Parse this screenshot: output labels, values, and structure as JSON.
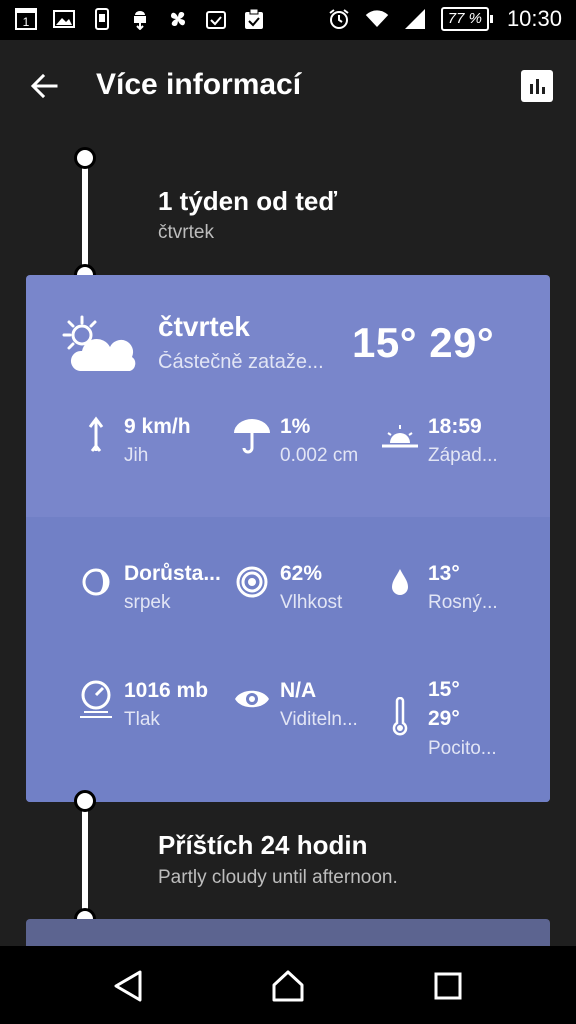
{
  "status_bar": {
    "time": "10:30",
    "battery": "77 %",
    "sim_badge": "1"
  },
  "app_bar": {
    "title": "Více informací"
  },
  "section_1": {
    "title": "1 týden od teď",
    "subtitle": "čtvrtek"
  },
  "forecast_card": {
    "day": "čtvrtek",
    "condition": "Částečně zataže...",
    "temp_low": "15°",
    "temp_high": "29°",
    "icon": "partly-cloudy-day-icon",
    "stats": [
      {
        "value": "9 km/h",
        "label": "Jih",
        "icon": "wind-direction-icon"
      },
      {
        "value": "1%",
        "label": "0.002 cm",
        "icon": "umbrella-icon"
      },
      {
        "value": "18:59",
        "label": "Západ...",
        "icon": "sunset-icon"
      },
      {
        "value": "Dorůsta...",
        "label": "srpek",
        "icon": "moon-phase-icon"
      },
      {
        "value": "62%",
        "label": "Vlhkost",
        "icon": "humidity-icon"
      },
      {
        "value": "13°",
        "label": "Rosný...",
        "icon": "dew-point-icon"
      },
      {
        "value": "1016 mb",
        "label": "Tlak",
        "icon": "pressure-gauge-icon"
      },
      {
        "value": "N/A",
        "label": "Viditeln...",
        "icon": "visibility-eye-icon"
      },
      {
        "value": "15°\n29°",
        "label": "Pocito...",
        "icon": "thermometer-icon"
      }
    ]
  },
  "section_2": {
    "title": "Příštích 24 hodin",
    "subtitle": "Partly cloudy until afternoon."
  },
  "colors": {
    "card": "#7986cb",
    "background": "#1f1f1f"
  }
}
